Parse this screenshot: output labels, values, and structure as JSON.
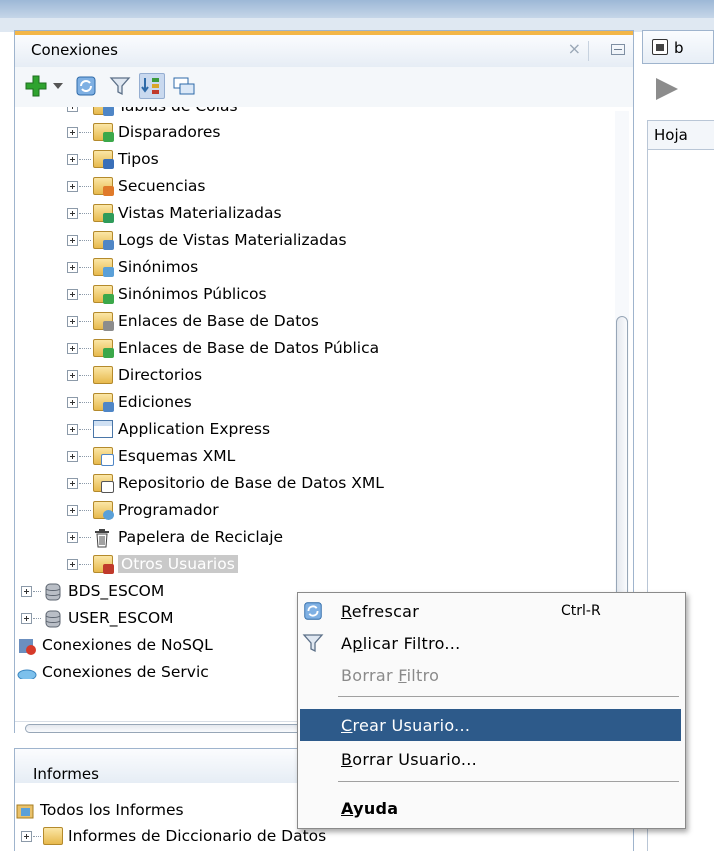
{
  "connections_panel": {
    "title": "Conexiones",
    "close_glyph": "×",
    "toolbar_icons": [
      "add-connection-icon",
      "dropdown-arrow-icon",
      "refresh-icon",
      "filter-icon",
      "schema-browser-icon",
      "manage-connections-icon"
    ]
  },
  "tree": {
    "items": [
      {
        "label": "Tablas de Colas",
        "icon": "queue-tables-icon"
      },
      {
        "label": "Disparadores",
        "icon": "triggers-icon"
      },
      {
        "label": "Tipos",
        "icon": "types-icon"
      },
      {
        "label": "Secuencias",
        "icon": "sequences-icon"
      },
      {
        "label": "Vistas Materializadas",
        "icon": "materialized-views-icon"
      },
      {
        "label": "Logs de Vistas Materializadas",
        "icon": "mv-logs-icon"
      },
      {
        "label": "Sinónimos",
        "icon": "synonyms-icon"
      },
      {
        "label": "Sinónimos Públicos",
        "icon": "public-synonyms-icon"
      },
      {
        "label": "Enlaces de Base de Datos",
        "icon": "db-links-icon"
      },
      {
        "label": "Enlaces de Base de Datos Pública",
        "icon": "public-db-links-icon"
      },
      {
        "label": "Directorios",
        "icon": "directories-icon"
      },
      {
        "label": "Ediciones",
        "icon": "editions-icon"
      },
      {
        "label": "Application Express",
        "icon": "application-express-icon"
      },
      {
        "label": "Esquemas XML",
        "icon": "xml-schemas-icon"
      },
      {
        "label": "Repositorio de Base de Datos XML",
        "icon": "xml-repository-icon"
      },
      {
        "label": "Programador",
        "icon": "scheduler-icon"
      },
      {
        "label": "Papelera de Reciclaje",
        "icon": "recycle-bin-icon"
      },
      {
        "label": "Otros Usuarios",
        "icon": "other-users-icon"
      }
    ],
    "connections": [
      {
        "label": "BDS_ESCOM",
        "icon": "database-icon"
      },
      {
        "label": "USER_ESCOM",
        "icon": "database-icon"
      }
    ],
    "groups": [
      {
        "label": "Conexiones de NoSQL",
        "icon": "nosql-connections-icon"
      },
      {
        "label": "Conexiones de Servic",
        "icon": "cloud-connections-icon"
      }
    ]
  },
  "reports_panel": {
    "title": "Informes",
    "items": [
      {
        "label": "Todos los Informes",
        "icon": "all-reports-icon"
      },
      {
        "label": "Informes de Diccionario de Datos",
        "icon": "dictionary-reports-icon"
      }
    ]
  },
  "editor": {
    "tab_label": "b",
    "sheet_tab": "Hoja"
  },
  "context_menu": {
    "refresh": {
      "pre": "",
      "u": "R",
      "post": "efrescar",
      "shortcut": "Ctrl-R"
    },
    "apply_filter": {
      "pre": "A",
      "u": "p",
      "post": "licar Filtro..."
    },
    "clear_filter": {
      "pre": "Borrar ",
      "u": "F",
      "post": "iltro"
    },
    "create_user": {
      "pre": "",
      "u": "C",
      "post": "rear Usuario..."
    },
    "delete_user": {
      "pre": "",
      "u": "B",
      "post": "orrar Usuario..."
    },
    "help": {
      "pre": "",
      "u": "A",
      "post": "yuda"
    }
  },
  "colors": {
    "accent": "#f3b648",
    "menu_highlight": "#2d5a8a",
    "add_green": "#2fa32f",
    "folder_yellow": "#e7b94d"
  }
}
